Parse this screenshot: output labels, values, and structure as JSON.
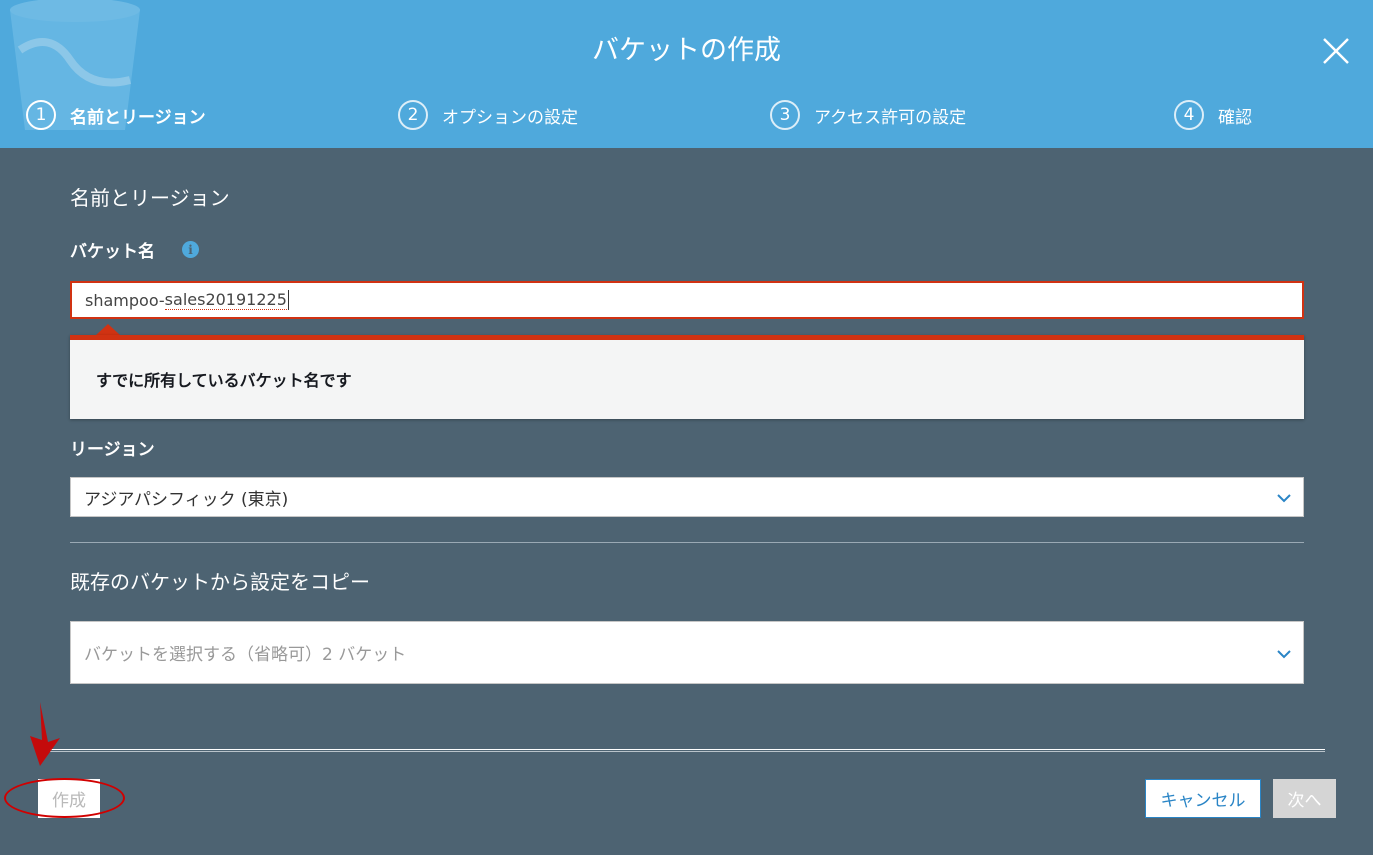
{
  "dialog": {
    "title": "バケットの作成",
    "close_icon": "close-icon"
  },
  "steps": [
    {
      "number": "1",
      "label": "名前とリージョン",
      "active": true
    },
    {
      "number": "2",
      "label": "オプションの設定",
      "active": false
    },
    {
      "number": "3",
      "label": "アクセス許可の設定",
      "active": false
    },
    {
      "number": "4",
      "label": "確認",
      "active": false
    }
  ],
  "form": {
    "section_title": "名前とリージョン",
    "bucket_name_label": "バケット名",
    "info_icon": "i",
    "bucket_name_prefix": "shampoo-",
    "bucket_name_misspelled": "sales20191225",
    "error_message": "すでに所有しているバケット名です",
    "region_label": "リージョン",
    "region_value": "アジアパシフィック (東京)",
    "copy_title": "既存のバケットから設定をコピー",
    "copy_placeholder": "バケットを選択する（省略可）2 バケット"
  },
  "footer": {
    "create_label": "作成",
    "cancel_label": "キャンセル",
    "next_label": "次へ"
  },
  "colors": {
    "header": "#4fa9dc",
    "body": "#4d6372",
    "error": "#d13212",
    "link": "#2a85c6",
    "annotation": "#d10000"
  }
}
